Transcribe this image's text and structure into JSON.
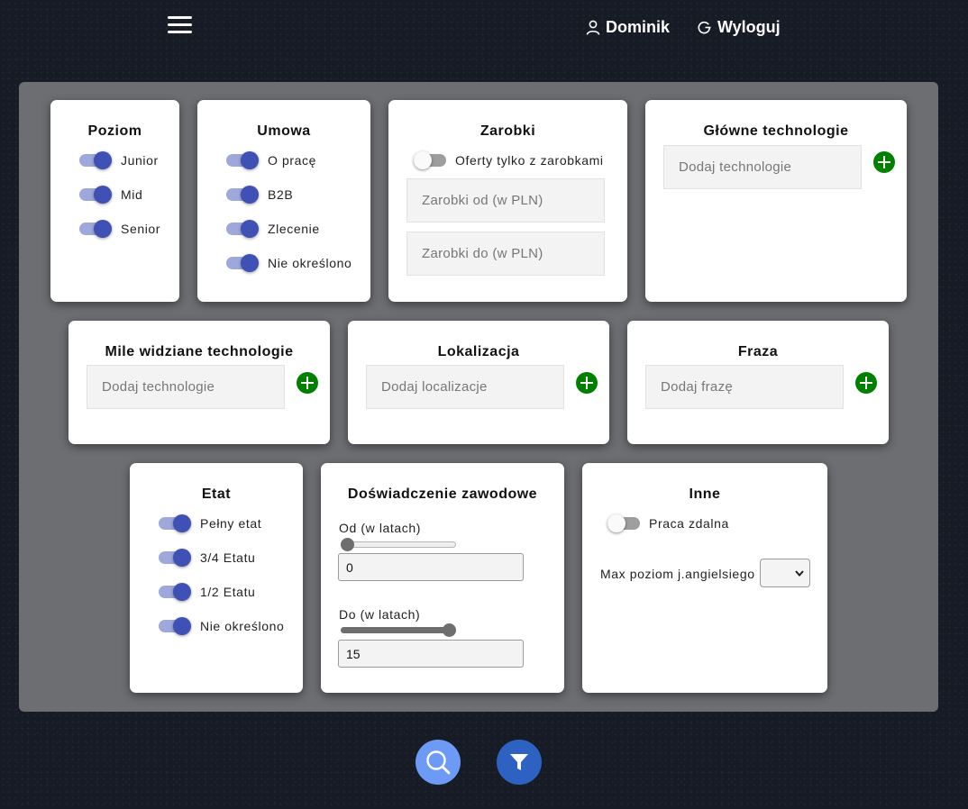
{
  "topbar": {
    "user_name": "Dominik",
    "logout_label": "Wyloguj"
  },
  "poziom": {
    "title": "Poziom",
    "options": [
      {
        "label": "Junior",
        "on": true
      },
      {
        "label": "Mid",
        "on": true
      },
      {
        "label": "Senior",
        "on": true
      }
    ]
  },
  "umowa": {
    "title": "Umowa",
    "options": [
      {
        "label": "O pracę",
        "on": true
      },
      {
        "label": "B2B",
        "on": true
      },
      {
        "label": "Zlecenie",
        "on": true
      },
      {
        "label": "Nie określono",
        "on": true
      }
    ]
  },
  "zarobki": {
    "title": "Zarobki",
    "only_salary_label": "Oferty tylko z zarobkami",
    "only_salary_on": false,
    "from_placeholder": "Zarobki od (w PLN)",
    "to_placeholder": "Zarobki do (w PLN)"
  },
  "glowne": {
    "title": "Główne technologie",
    "placeholder": "Dodaj technologie"
  },
  "mile": {
    "title": "Mile widziane technologie",
    "placeholder": "Dodaj technologie"
  },
  "lokalizacja": {
    "title": "Lokalizacja",
    "placeholder": "Dodaj localizacje"
  },
  "fraza": {
    "title": "Fraza",
    "placeholder": "Dodaj frazę"
  },
  "etat": {
    "title": "Etat",
    "options": [
      {
        "label": "Pełny etat",
        "on": true
      },
      {
        "label": "3/4 Etatu",
        "on": true
      },
      {
        "label": "1/2 Etatu",
        "on": true
      },
      {
        "label": "Nie określono",
        "on": true
      }
    ]
  },
  "doswiadczenie": {
    "title": "Doświadczenie zawodowe",
    "from_label": "Od (w latach)",
    "from_value": "0",
    "from_slider_fraction": 0,
    "to_label": "Do (w latach)",
    "to_value": "15",
    "to_slider_fraction": 1
  },
  "inne": {
    "title": "Inne",
    "remote_label": "Praca zdalna",
    "remote_on": false,
    "english_label": "Max poziom j.angielsiego",
    "english_value": ""
  },
  "colors": {
    "toggle_on": "#3f51b5",
    "add_button": "#008000",
    "search_fab": "#6c9af5",
    "filter_fab": "#2d62c2"
  }
}
